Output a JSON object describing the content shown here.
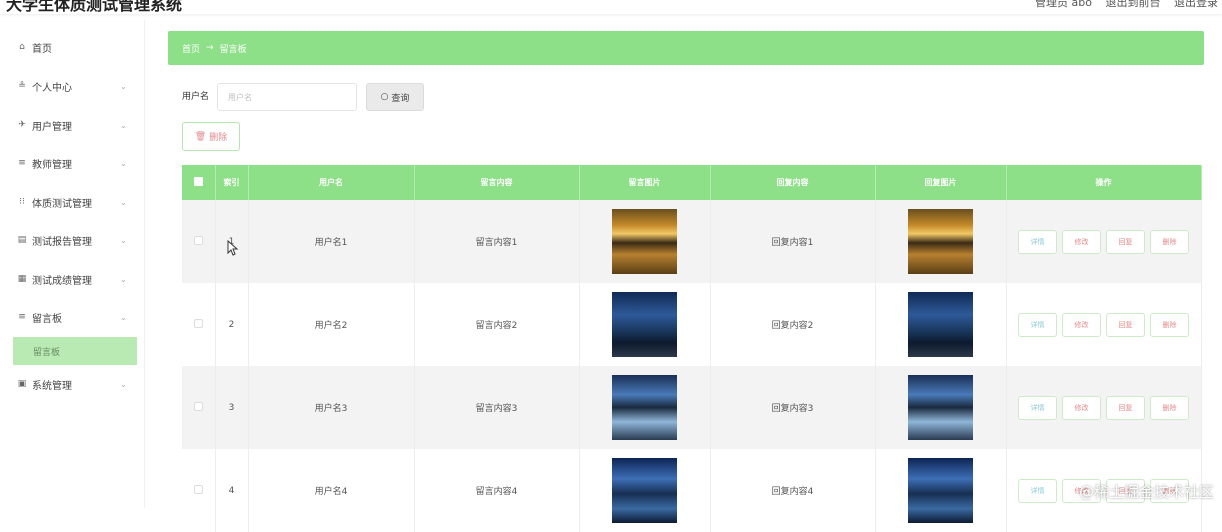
{
  "header": {
    "app_title": "大学生体质测试管理系统",
    "user_label": "管理员 abo",
    "exit_frontend": "退出到前台",
    "logout": "退出登录"
  },
  "sidebar": {
    "items": [
      {
        "label": "首页",
        "icon": "home-icon",
        "has_children": false
      },
      {
        "label": "个人中心",
        "icon": "user-icon",
        "has_children": true
      },
      {
        "label": "用户管理",
        "icon": "users-icon",
        "has_children": true
      },
      {
        "label": "教师管理",
        "icon": "list-icon",
        "has_children": true
      },
      {
        "label": "体质测试管理",
        "icon": "grid-icon",
        "has_children": true
      },
      {
        "label": "测试报告管理",
        "icon": "report-icon",
        "has_children": true
      },
      {
        "label": "测试成绩管理",
        "icon": "score-icon",
        "has_children": true
      },
      {
        "label": "留言板",
        "icon": "message-icon",
        "has_children": true
      },
      {
        "label": "系统管理",
        "icon": "settings-icon",
        "has_children": true
      }
    ],
    "active_sub": "留言板"
  },
  "breadcrumb": {
    "home": "首页",
    "separator": "→",
    "current": "留言板"
  },
  "search": {
    "label": "用户名",
    "placeholder": "用户名",
    "button": "查询"
  },
  "toolbar": {
    "delete_label": "删除"
  },
  "table": {
    "columns": [
      "",
      "索引",
      "用户名",
      "留言内容",
      "留言图片",
      "回复内容",
      "回复图片",
      "操作"
    ],
    "rows": [
      {
        "index": "1",
        "username": "用户名1",
        "message": "留言内容1",
        "reply": "回复内容1",
        "msg_image": "sunset",
        "reply_image": "sunset"
      },
      {
        "index": "2",
        "username": "用户名2",
        "message": "留言内容2",
        "reply": "回复内容2",
        "msg_image": "night1",
        "reply_image": "night1"
      },
      {
        "index": "3",
        "username": "用户名3",
        "message": "留言内容3",
        "reply": "回复内容3",
        "msg_image": "river",
        "reply_image": "river"
      },
      {
        "index": "4",
        "username": "用户名4",
        "message": "留言内容4",
        "reply": "回复内容4",
        "msg_image": "lake",
        "reply_image": "lake"
      }
    ],
    "actions": {
      "detail": "详情",
      "edit": "修改",
      "reply": "回复",
      "delete": "删除"
    }
  },
  "watermark": "@稀土掘金技术社区",
  "colors": {
    "accent": "#8ee088",
    "active_sub_bg": "#b9eab3",
    "danger_text": "#e58a8a",
    "info_text": "#8bc8d8"
  }
}
